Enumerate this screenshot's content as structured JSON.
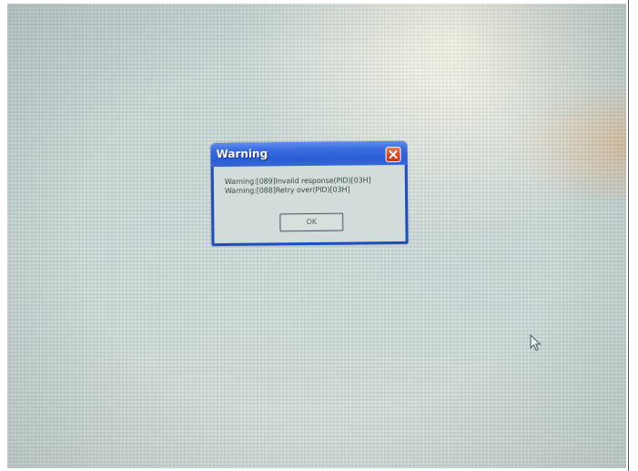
{
  "dialog": {
    "title": "Warning",
    "messages": [
      "Warning:[089]Invalid response(PID)[03H]",
      "Warning:[088]Retry over(PID)[03H]"
    ],
    "ok_label": "OK"
  },
  "icons": {
    "close": "close-icon",
    "cursor": "mouse-pointer-icon"
  },
  "colors": {
    "titlebar": "#2a5cd4",
    "close_button": "#d4441e",
    "dialog_body": "#d2dcda",
    "desktop": "#c8d8d6"
  }
}
